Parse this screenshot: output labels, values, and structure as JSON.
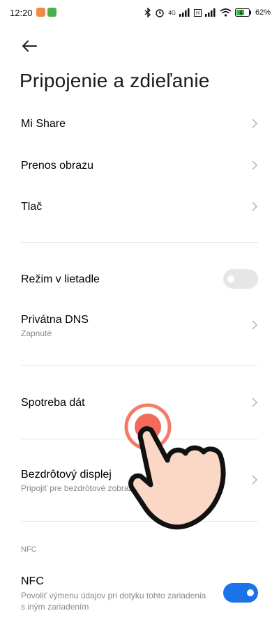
{
  "status_bar": {
    "time": "12:20",
    "network_label": "4G",
    "battery": "62"
  },
  "header": {
    "title": "Pripojenie a zdieľanie"
  },
  "items": {
    "mi_share": "Mi Share",
    "screencast": "Prenos obrazu",
    "print": "Tlač",
    "airplane_mode": "Režim v lietadle",
    "private_dns": "Privátna DNS",
    "private_dns_sub": "Zapnuté",
    "data_usage": "Spotreba dát",
    "wireless_display": "Bezdrôtový displej",
    "wireless_display_sub": "Pripojiť pre bezdrôtové zobraz",
    "nfc_section": "NFC",
    "nfc": "NFC",
    "nfc_sub_line1": "Povoliť výmenu údajov pri dotyku tohto zariadenia",
    "nfc_sub_line2": "s iným zariadením"
  },
  "toggles": {
    "airplane_mode_on": false,
    "nfc_on": true
  },
  "colors": {
    "accent": "#1a73e8",
    "toggle_off": "#e6e6e6",
    "tap_ring": "#f36b5a"
  },
  "icons": [
    "back-arrow-icon",
    "chevron-right-icon",
    "bluetooth-icon",
    "alarm-icon",
    "signal-icon",
    "wifi-icon",
    "battery-icon",
    "hand-pointer-icon"
  ]
}
